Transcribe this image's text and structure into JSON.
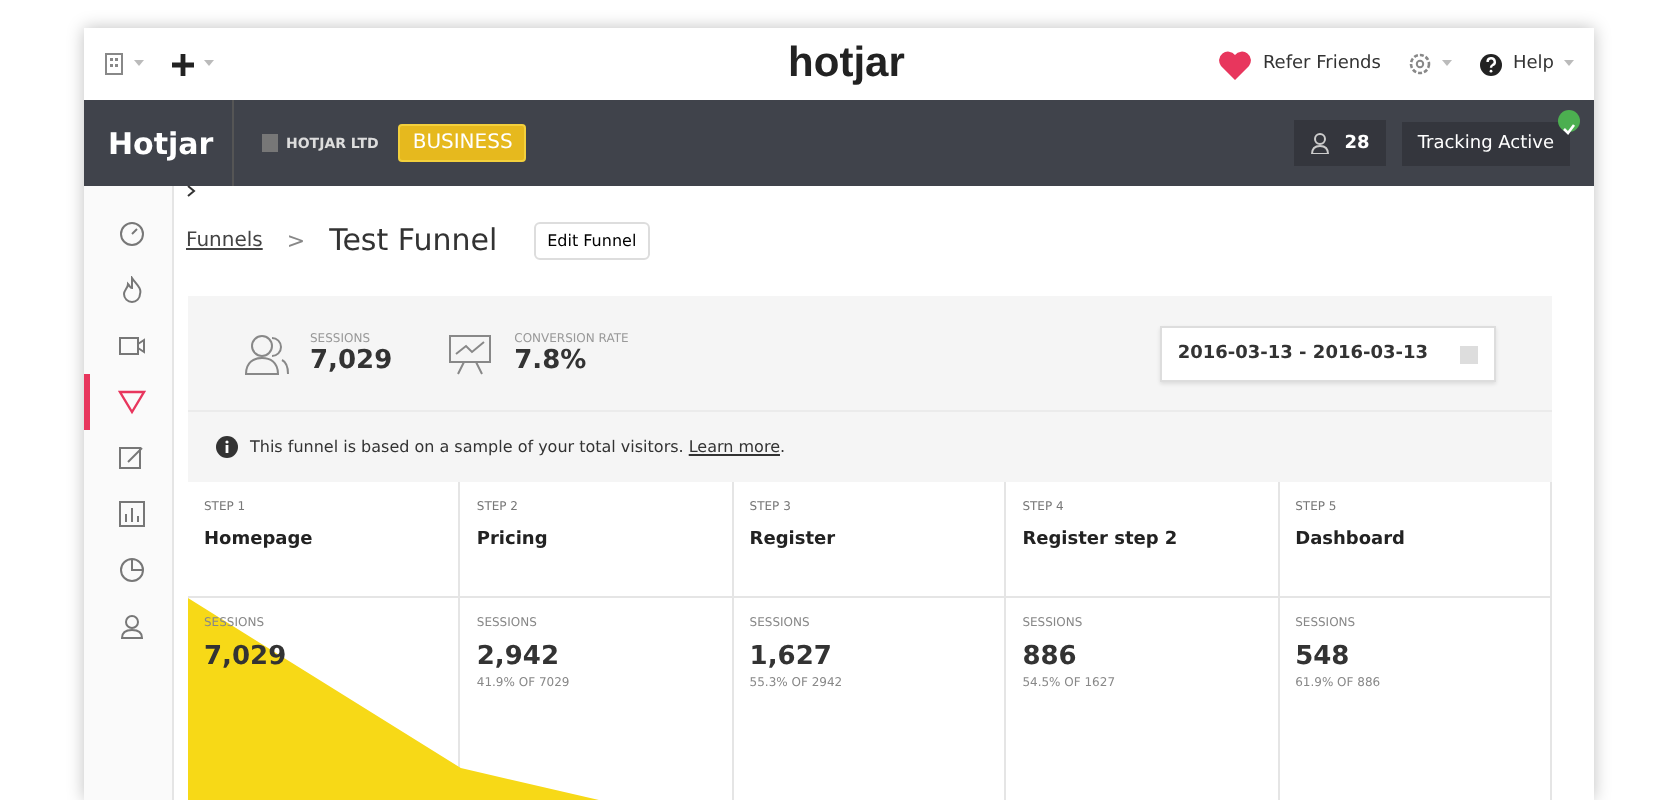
{
  "topbar": {
    "logo": "hotjar",
    "refer": "Refer Friends",
    "help": "Help"
  },
  "header": {
    "brand": "Hotjar",
    "org": "HOTJAR LTD",
    "plan": "BUSINESS",
    "users": "28",
    "tracking": "Tracking Active",
    "tracking_on": true
  },
  "sidebar": {
    "items": [
      {
        "kind": "dashboard",
        "selected": false
      },
      {
        "kind": "heatmap",
        "selected": false
      },
      {
        "kind": "recording",
        "selected": false
      },
      {
        "kind": "funnel",
        "selected": true
      },
      {
        "kind": "form",
        "selected": false
      },
      {
        "kind": "chart",
        "selected": false
      },
      {
        "kind": "poll",
        "selected": false
      },
      {
        "kind": "user",
        "selected": false
      }
    ]
  },
  "breadcrumb": {
    "parent": "Funnels",
    "separator": ">",
    "title": "Test Funnel",
    "edit": "Edit Funnel"
  },
  "stats": [
    {
      "kind": "sessions",
      "label": "SESSIONS",
      "value": "7,029"
    },
    {
      "kind": "conversion",
      "label": "CONVERSION RATE",
      "value": "7.8%"
    }
  ],
  "date_range": "2016-03-13 - 2016-03-13",
  "notice": {
    "text": "This funnel is based on a sample of your total visitors. ",
    "link": "Learn more",
    "end": "."
  },
  "steps": [
    {
      "step": "STEP 1",
      "name": "Homepage",
      "label": "SESSIONS",
      "value": "7,029"
    },
    {
      "step": "STEP 2",
      "name": "Pricing",
      "label": "SESSIONS",
      "value": "2,942",
      "sub": "41.9% OF 7029"
    },
    {
      "step": "STEP 3",
      "name": "Register",
      "label": "SESSIONS",
      "value": "1,627",
      "sub": "55.3% OF 2942"
    },
    {
      "step": "STEP 4",
      "name": "Register step 2",
      "label": "SESSIONS",
      "value": "886",
      "sub": "54.5% OF 1627"
    },
    {
      "step": "STEP 5",
      "name": "Dashboard",
      "label": "SESSIONS",
      "value": "548",
      "sub": "61.9% OF 886"
    }
  ]
}
